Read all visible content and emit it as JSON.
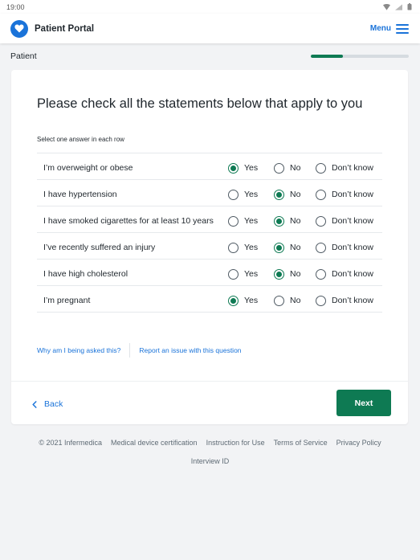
{
  "statusbar": {
    "time": "19:00"
  },
  "header": {
    "brand_name": "Patient Portal",
    "menu_label": "Menu"
  },
  "subheader": {
    "section": "Patient",
    "progress": 0.33
  },
  "question": {
    "title": "Please check all the statements below that apply to you",
    "hint": "Select one answer in each row",
    "options": [
      "Yes",
      "No",
      "Don’t know"
    ],
    "rows": [
      {
        "label": "I’m overweight or obese",
        "answer": "Yes"
      },
      {
        "label": "I have hypertension",
        "answer": "No"
      },
      {
        "label": "I have smoked cigarettes for at least 10 years",
        "answer": "No"
      },
      {
        "label": "I’ve recently suffered an injury",
        "answer": "No"
      },
      {
        "label": "I have high cholesterol",
        "answer": "No"
      },
      {
        "label": "I’m pregnant",
        "answer": "Yes"
      }
    ]
  },
  "links": {
    "why": "Why am I being asked this?",
    "report": "Report an issue with this question"
  },
  "nav": {
    "back_label": "Back",
    "next_label": "Next"
  },
  "footer": {
    "copyright": "© 2021 Infermedica",
    "links": [
      "Medical device certification",
      "Instruction for Use",
      "Terms of Service",
      "Privacy Policy"
    ],
    "interview_id": "Interview ID"
  },
  "colors": {
    "brand_blue": "#1a73d9",
    "accent_green": "#0e7a53"
  }
}
